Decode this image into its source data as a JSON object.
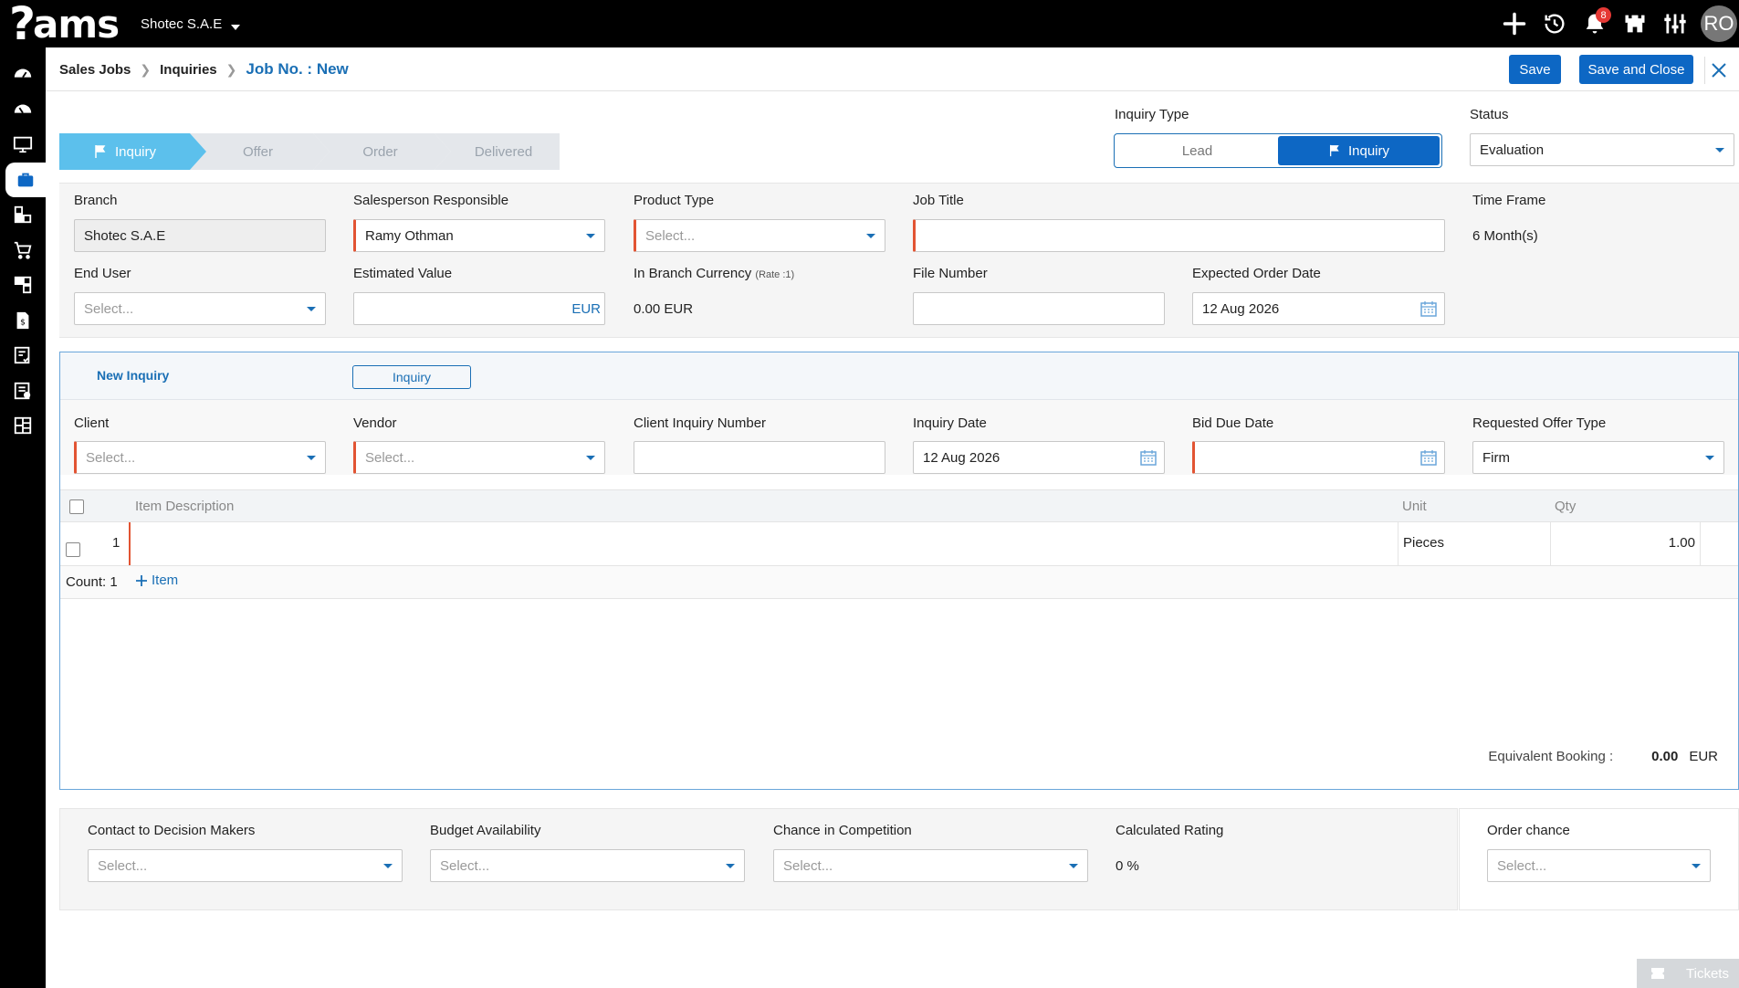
{
  "topbar": {
    "logo_text": "ams",
    "company": "Shotec S.A.E",
    "notifications_count": "8",
    "avatar_initials": "RO"
  },
  "breadcrumb": {
    "level1": "Sales Jobs",
    "level2": "Inquiries",
    "current": "Job No. : New"
  },
  "actions": {
    "save": "Save",
    "save_close": "Save and Close"
  },
  "stepper": [
    "Inquiry",
    "Offer",
    "Order",
    "Delivered"
  ],
  "inquiry_type": {
    "label": "Inquiry Type",
    "options": [
      "Lead",
      "Inquiry"
    ],
    "selected": "Inquiry"
  },
  "status": {
    "label": "Status",
    "value": "Evaluation"
  },
  "form": {
    "branch": {
      "label": "Branch",
      "value": "Shotec S.A.E"
    },
    "salesperson": {
      "label": "Salesperson Responsible",
      "value": "Ramy  Othman"
    },
    "product_type": {
      "label": "Product Type",
      "placeholder": "Select..."
    },
    "job_title": {
      "label": "Job Title",
      "value": ""
    },
    "time_frame": {
      "label": "Time Frame",
      "value": "6 Month(s)"
    },
    "end_user": {
      "label": "End User",
      "placeholder": "Select..."
    },
    "estimated_value": {
      "label": "Estimated Value",
      "unit": "EUR"
    },
    "branch_currency": {
      "label": "In Branch Currency",
      "rate": "(Rate :1)",
      "value": "0.00  EUR"
    },
    "file_number": {
      "label": "File Number",
      "value": ""
    },
    "expected_order_date": {
      "label": "Expected Order Date",
      "value": "12 Aug 2026"
    }
  },
  "inquiry": {
    "title": "New Inquiry",
    "tag": "Inquiry",
    "client": {
      "label": "Client",
      "placeholder": "Select..."
    },
    "vendor": {
      "label": "Vendor",
      "placeholder": "Select..."
    },
    "client_inquiry_number": {
      "label": "Client Inquiry Number",
      "value": ""
    },
    "inquiry_date": {
      "label": "Inquiry Date",
      "value": "12 Aug 2026"
    },
    "bid_due_date": {
      "label": "Bid Due Date",
      "value": ""
    },
    "requested_offer_type": {
      "label": "Requested Offer Type",
      "value": "Firm"
    },
    "grid": {
      "columns": [
        "Item Description",
        "Unit",
        "Qty"
      ],
      "rows": [
        {
          "no": "1",
          "description": "",
          "unit": "Pieces",
          "qty": "1.00"
        }
      ],
      "count_label": "Count: 1",
      "add_item": "Item"
    },
    "equivalent_booking": {
      "label": "Equivalent Booking :",
      "value": "0.00",
      "currency": "EUR"
    }
  },
  "rating": {
    "contact": {
      "label": "Contact to Decision Makers",
      "placeholder": "Select..."
    },
    "budget": {
      "label": "Budget Availability",
      "placeholder": "Select..."
    },
    "competition": {
      "label": "Chance in Competition",
      "placeholder": "Select..."
    },
    "calculated": {
      "label": "Calculated Rating",
      "value": "0 %"
    },
    "order_chance": {
      "label": "Order chance",
      "placeholder": "Select..."
    }
  },
  "tickets": "Tickets"
}
